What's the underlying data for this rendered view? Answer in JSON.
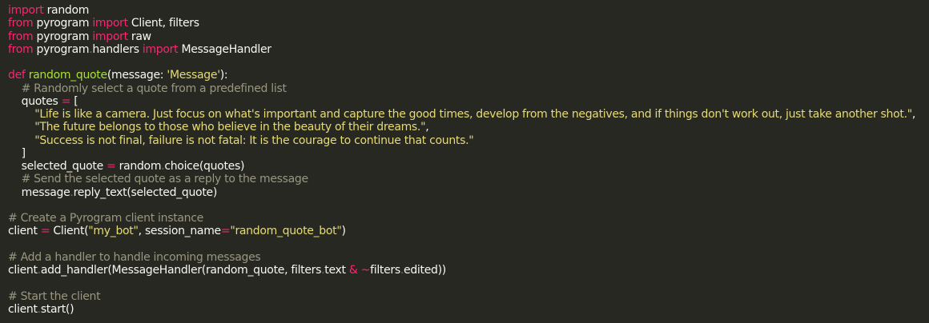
{
  "code": {
    "lines": [
      [
        {
          "t": "import",
          "c": "keyword"
        },
        {
          "t": " random",
          "c": "plain"
        }
      ],
      [
        {
          "t": "from",
          "c": "keyword"
        },
        {
          "t": " pyrogram ",
          "c": "plain"
        },
        {
          "t": "import",
          "c": "keyword"
        },
        {
          "t": " Client, filters",
          "c": "plain"
        }
      ],
      [
        {
          "t": "from",
          "c": "keyword"
        },
        {
          "t": " pyrogram ",
          "c": "plain"
        },
        {
          "t": "import",
          "c": "keyword"
        },
        {
          "t": " raw",
          "c": "plain"
        }
      ],
      [
        {
          "t": "from",
          "c": "keyword"
        },
        {
          "t": " pyrogram",
          "c": "plain"
        },
        {
          "t": ".",
          "c": "dot"
        },
        {
          "t": "handlers ",
          "c": "plain"
        },
        {
          "t": "import",
          "c": "keyword"
        },
        {
          "t": " MessageHandler",
          "c": "plain"
        }
      ],
      [],
      [
        {
          "t": "def",
          "c": "keyword"
        },
        {
          "t": " ",
          "c": "plain"
        },
        {
          "t": "random_quote",
          "c": "func"
        },
        {
          "t": "(message: ",
          "c": "plain"
        },
        {
          "t": "'Message'",
          "c": "string"
        },
        {
          "t": "):",
          "c": "plain"
        }
      ],
      [
        {
          "t": "    # Randomly select a quote from a predefined list",
          "c": "comment"
        }
      ],
      [
        {
          "t": "    quotes ",
          "c": "plain"
        },
        {
          "t": "=",
          "c": "op"
        },
        {
          "t": " [",
          "c": "plain"
        }
      ],
      [
        {
          "t": "        ",
          "c": "plain"
        },
        {
          "t": "\"Life is like a camera. Just focus on what's important and capture the good times, develop from the negatives, and if things don't work out, just take another shot.\"",
          "c": "string"
        },
        {
          "t": ",",
          "c": "plain"
        }
      ],
      [
        {
          "t": "        ",
          "c": "plain"
        },
        {
          "t": "\"The future belongs to those who believe in the beauty of their dreams.\"",
          "c": "string"
        },
        {
          "t": ",",
          "c": "plain"
        }
      ],
      [
        {
          "t": "        ",
          "c": "plain"
        },
        {
          "t": "\"Success is not final, failure is not fatal: It is the courage to continue that counts.\"",
          "c": "string"
        }
      ],
      [
        {
          "t": "    ]",
          "c": "plain"
        }
      ],
      [
        {
          "t": "    selected_quote ",
          "c": "plain"
        },
        {
          "t": "=",
          "c": "op"
        },
        {
          "t": " random",
          "c": "plain"
        },
        {
          "t": ".",
          "c": "dot"
        },
        {
          "t": "choice(quotes)",
          "c": "plain"
        }
      ],
      [
        {
          "t": "    # Send the selected quote as a reply to the message",
          "c": "comment"
        }
      ],
      [
        {
          "t": "    message",
          "c": "plain"
        },
        {
          "t": ".",
          "c": "dot"
        },
        {
          "t": "reply_text(selected_quote)",
          "c": "plain"
        }
      ],
      [],
      [
        {
          "t": "# Create a Pyrogram client instance",
          "c": "comment"
        }
      ],
      [
        {
          "t": "client ",
          "c": "plain"
        },
        {
          "t": "=",
          "c": "op"
        },
        {
          "t": " Client(",
          "c": "plain"
        },
        {
          "t": "\"my_bot\"",
          "c": "string"
        },
        {
          "t": ", session_name",
          "c": "plain"
        },
        {
          "t": "=",
          "c": "op"
        },
        {
          "t": "\"random_quote_bot\"",
          "c": "string"
        },
        {
          "t": ")",
          "c": "plain"
        }
      ],
      [],
      [
        {
          "t": "# Add a handler to handle incoming messages",
          "c": "comment"
        }
      ],
      [
        {
          "t": "client",
          "c": "plain"
        },
        {
          "t": ".",
          "c": "dot"
        },
        {
          "t": "add_handler(MessageHandler(random_quote, filters",
          "c": "plain"
        },
        {
          "t": ".",
          "c": "dot"
        },
        {
          "t": "text ",
          "c": "plain"
        },
        {
          "t": "&",
          "c": "op"
        },
        {
          "t": " ",
          "c": "plain"
        },
        {
          "t": "~",
          "c": "op"
        },
        {
          "t": "filters",
          "c": "plain"
        },
        {
          "t": ".",
          "c": "dot"
        },
        {
          "t": "edited))",
          "c": "plain"
        }
      ],
      [],
      [
        {
          "t": "# Start the client",
          "c": "comment"
        }
      ],
      [
        {
          "t": "client",
          "c": "plain"
        },
        {
          "t": ".",
          "c": "dot"
        },
        {
          "t": "start()",
          "c": "plain"
        }
      ]
    ]
  },
  "colors": {
    "background": "#272822",
    "keyword": "#f92672",
    "function": "#a6e22e",
    "string": "#e6db74",
    "comment": "#9a9780",
    "text": "#f8f8f2"
  }
}
